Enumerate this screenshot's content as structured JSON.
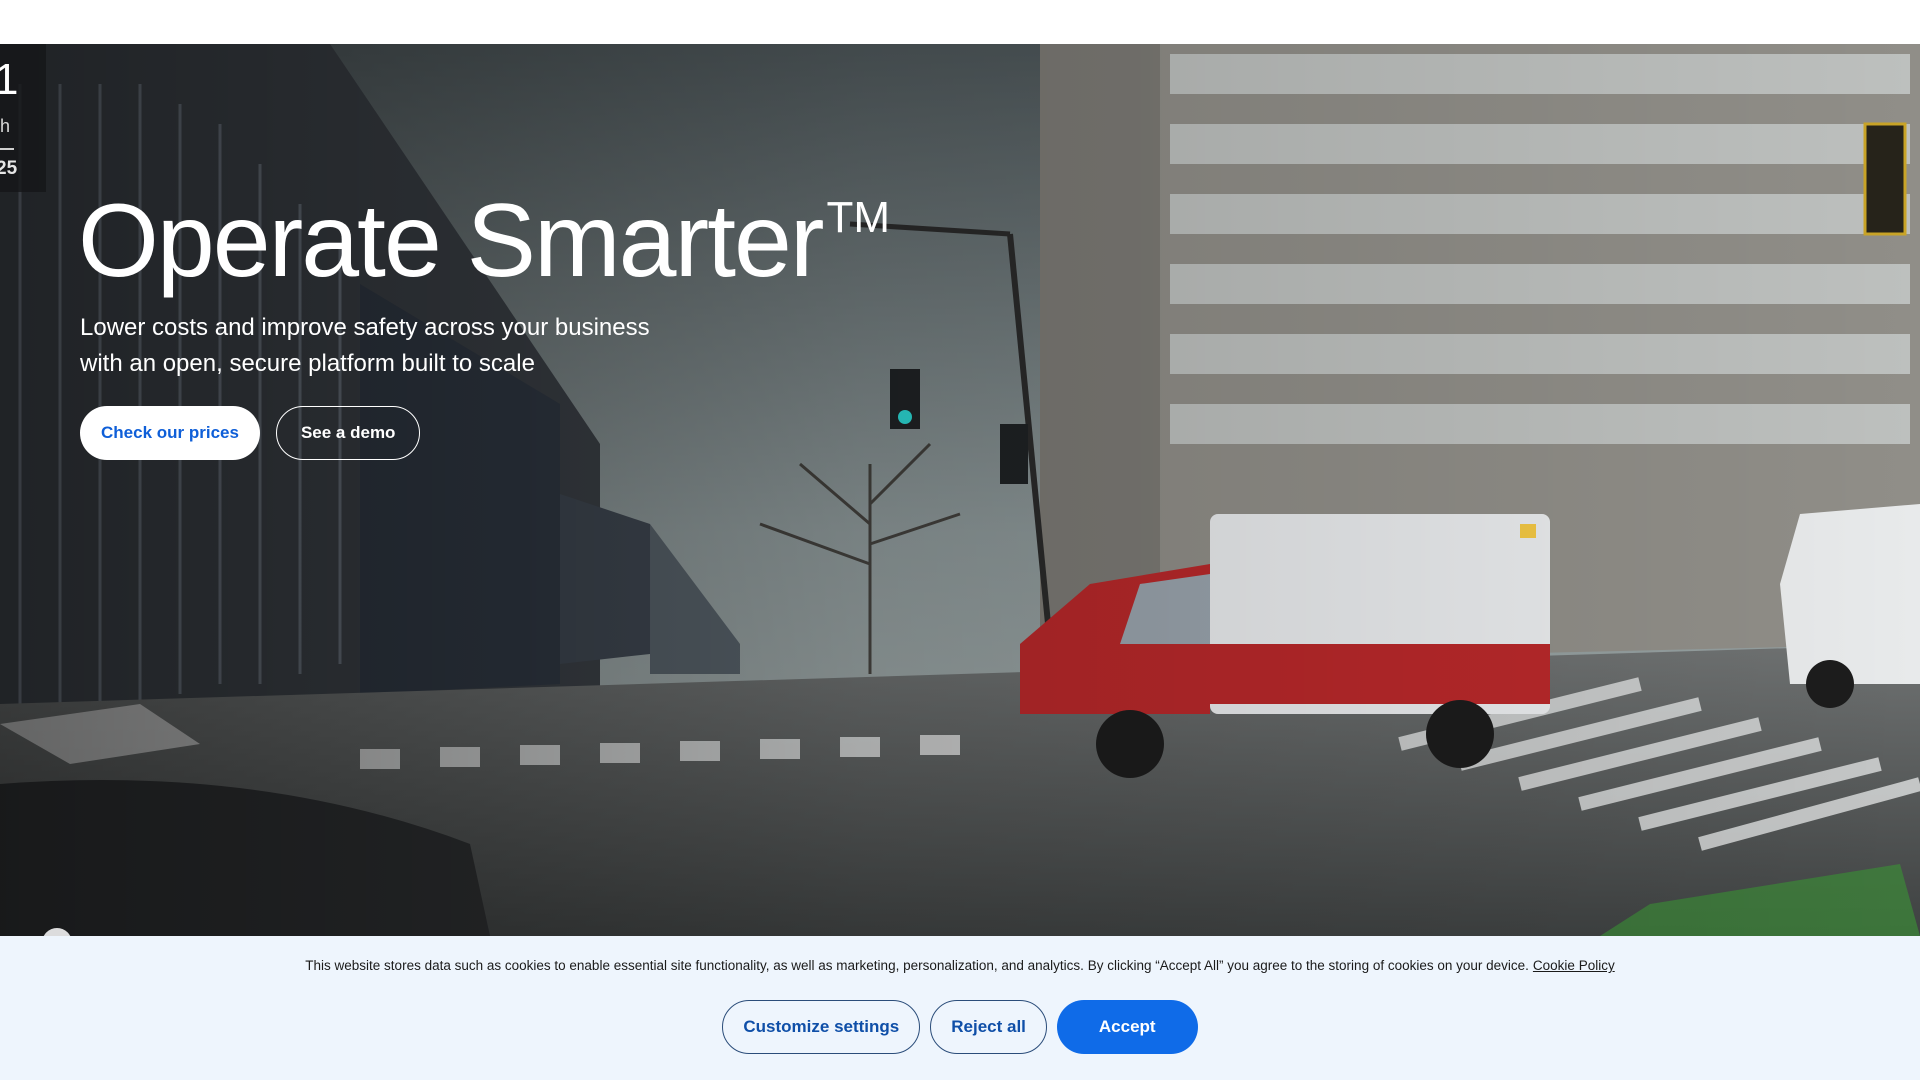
{
  "hero": {
    "title": "Operate Smarter",
    "trademark": "TM",
    "subtitle_line1": "Lower costs and improve safety across your business",
    "subtitle_line2": "with an open, secure platform built to scale",
    "primary_button": "Check our prices",
    "secondary_button": "See a demo",
    "video_overlay": {
      "speed_digit": "1",
      "speed_unit": "h",
      "limit": "25"
    }
  },
  "cookie_banner": {
    "message": "This website stores data such as cookies to enable essential site functionality, as well as marketing, personalization, and analytics. By clicking “Accept All” you agree to the storing of cookies on your device.",
    "policy_link": "Cookie Policy",
    "customize_button": "Customize settings",
    "reject_button": "Reject all",
    "accept_button": "Accept"
  },
  "colors": {
    "primary_blue": "#0f6be8",
    "link_blue": "#0f5fd8",
    "banner_bg": "#eef5fd",
    "ambulance_red": "#b8282a"
  }
}
